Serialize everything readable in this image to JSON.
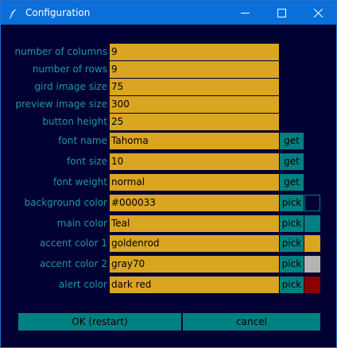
{
  "window": {
    "title": "Configuration"
  },
  "fields": [
    {
      "label": "number of columns",
      "value": "9"
    },
    {
      "label": "number of rows",
      "value": "9"
    },
    {
      "label": "gird image size",
      "value": "75"
    },
    {
      "label": "preview image size",
      "value": "300"
    },
    {
      "label": "button height",
      "value": "25"
    },
    {
      "label": "font name",
      "value": "Tahoma",
      "button": "get"
    },
    {
      "label": "font size",
      "value": "10",
      "button": "get"
    },
    {
      "label": "font weight",
      "value": "normal",
      "button": "get"
    },
    {
      "label": "background color",
      "value": "#000033",
      "button": "pick",
      "swatch": "#000033"
    },
    {
      "label": "main color",
      "value": "Teal",
      "button": "pick",
      "swatch": "#008080"
    },
    {
      "label": "accent color 1",
      "value": "goldenrod",
      "button": "pick",
      "swatch": "#daa520"
    },
    {
      "label": "accent color 2",
      "value": "gray70",
      "button": "pick",
      "swatch": "#b3b3b3"
    },
    {
      "label": "alert color",
      "value": "dark red",
      "button": "pick",
      "swatch": "#8b0000"
    }
  ],
  "buttons": {
    "ok": "OK (restart)",
    "cancel": "cancel"
  },
  "colors": {
    "titlebar": "#0a6fd8",
    "background": "#000033",
    "label_text": "#1f9a9a",
    "field": "#daa520",
    "button": "#008080"
  },
  "icons": {
    "app": "feather-icon",
    "minimize": "minimize-icon",
    "maximize": "maximize-icon",
    "close": "close-icon"
  }
}
